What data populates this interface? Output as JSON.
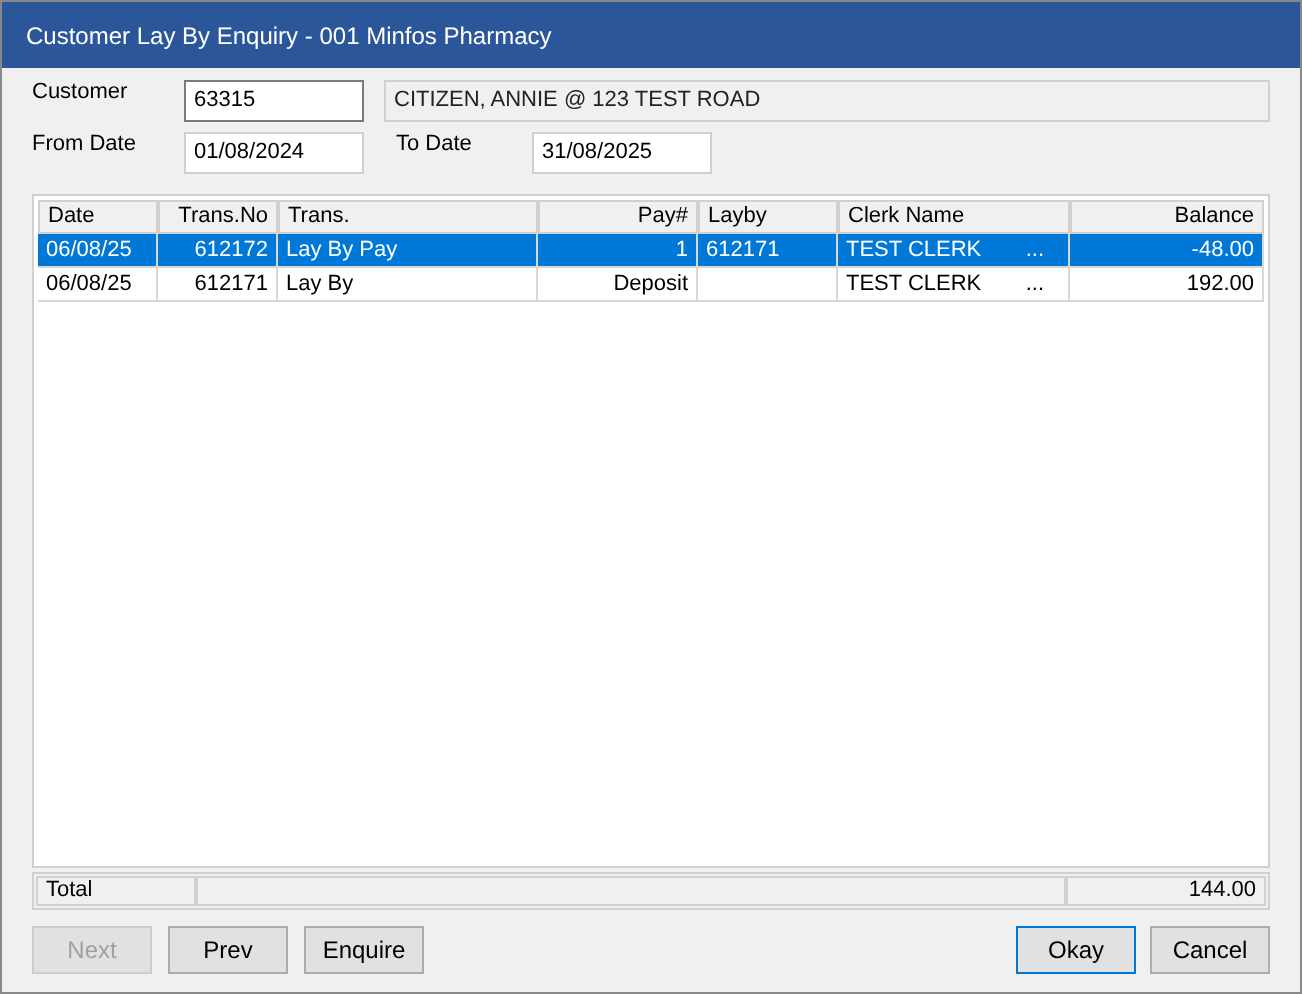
{
  "window": {
    "title": "Customer Lay By Enquiry - 001 Minfos Pharmacy"
  },
  "customer": {
    "label": "Customer",
    "value": "63315",
    "name": "CITIZEN, ANNIE @ 123 TEST ROAD"
  },
  "from_date": {
    "label": "From Date",
    "value": "01/08/2024"
  },
  "to_date": {
    "label": "To Date",
    "value": "31/08/2025"
  },
  "table": {
    "columns": [
      "Date",
      "Trans.No",
      "Trans.",
      "Pay#",
      "Layby",
      "Clerk Name",
      "Balance"
    ],
    "rows": [
      {
        "selected": true,
        "cells": [
          "06/08/25",
          "612172",
          "Lay By Pay",
          "1",
          "612171",
          "TEST CLERK",
          "-48.00"
        ],
        "clerk_more": "..."
      },
      {
        "selected": false,
        "cells": [
          "06/08/25",
          "612171",
          "Lay By",
          "Deposit",
          "",
          "TEST CLERK",
          "192.00"
        ],
        "clerk_more": "..."
      }
    ]
  },
  "total": {
    "label": "Total",
    "value": "144.00"
  },
  "nav_buttons": [
    {
      "label": "Next",
      "disabled": true
    },
    {
      "label": "Prev",
      "disabled": false
    },
    {
      "label": "Enquire",
      "disabled": false
    }
  ],
  "dialog_buttons": [
    {
      "label": "Okay",
      "default": true
    },
    {
      "label": "Cancel",
      "default": false
    }
  ]
}
